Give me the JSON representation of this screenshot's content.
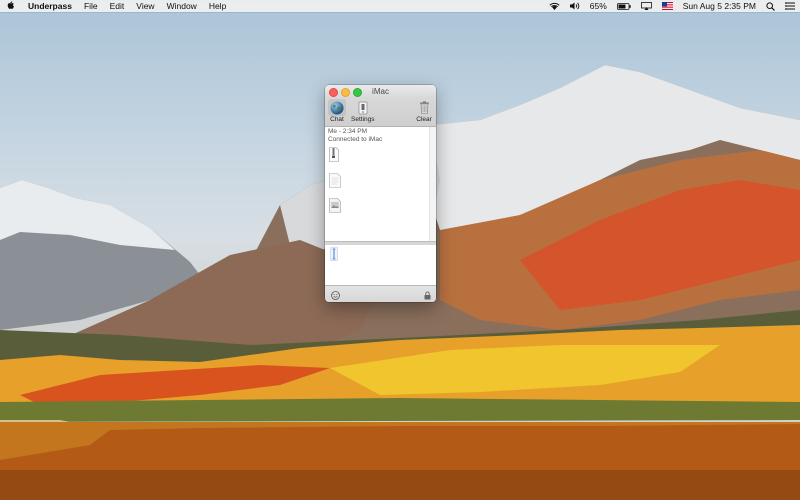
{
  "menubar": {
    "apple_icon": "apple-icon",
    "app_name": "Underpass",
    "items": [
      "File",
      "Edit",
      "View",
      "Window",
      "Help"
    ],
    "status": {
      "battery_percent": "65%",
      "datetime": "Sun Aug 5  2:35 PM",
      "icons": [
        "wifi-icon",
        "volume-icon",
        "battery-icon",
        "airplay-icon",
        "flag-icon",
        "search-icon",
        "control-center-icon"
      ]
    }
  },
  "window": {
    "title": "iMac",
    "toolbar": {
      "chat_label": "Chat",
      "settings_label": "Settings",
      "clear_label": "Clear"
    },
    "transcript": {
      "sender_time": "Me - 2:34 PM",
      "status": "Connected to iMac"
    }
  },
  "colors": {
    "close": "#fc605c",
    "minimize": "#fdbc40",
    "zoom": "#34c84a"
  }
}
